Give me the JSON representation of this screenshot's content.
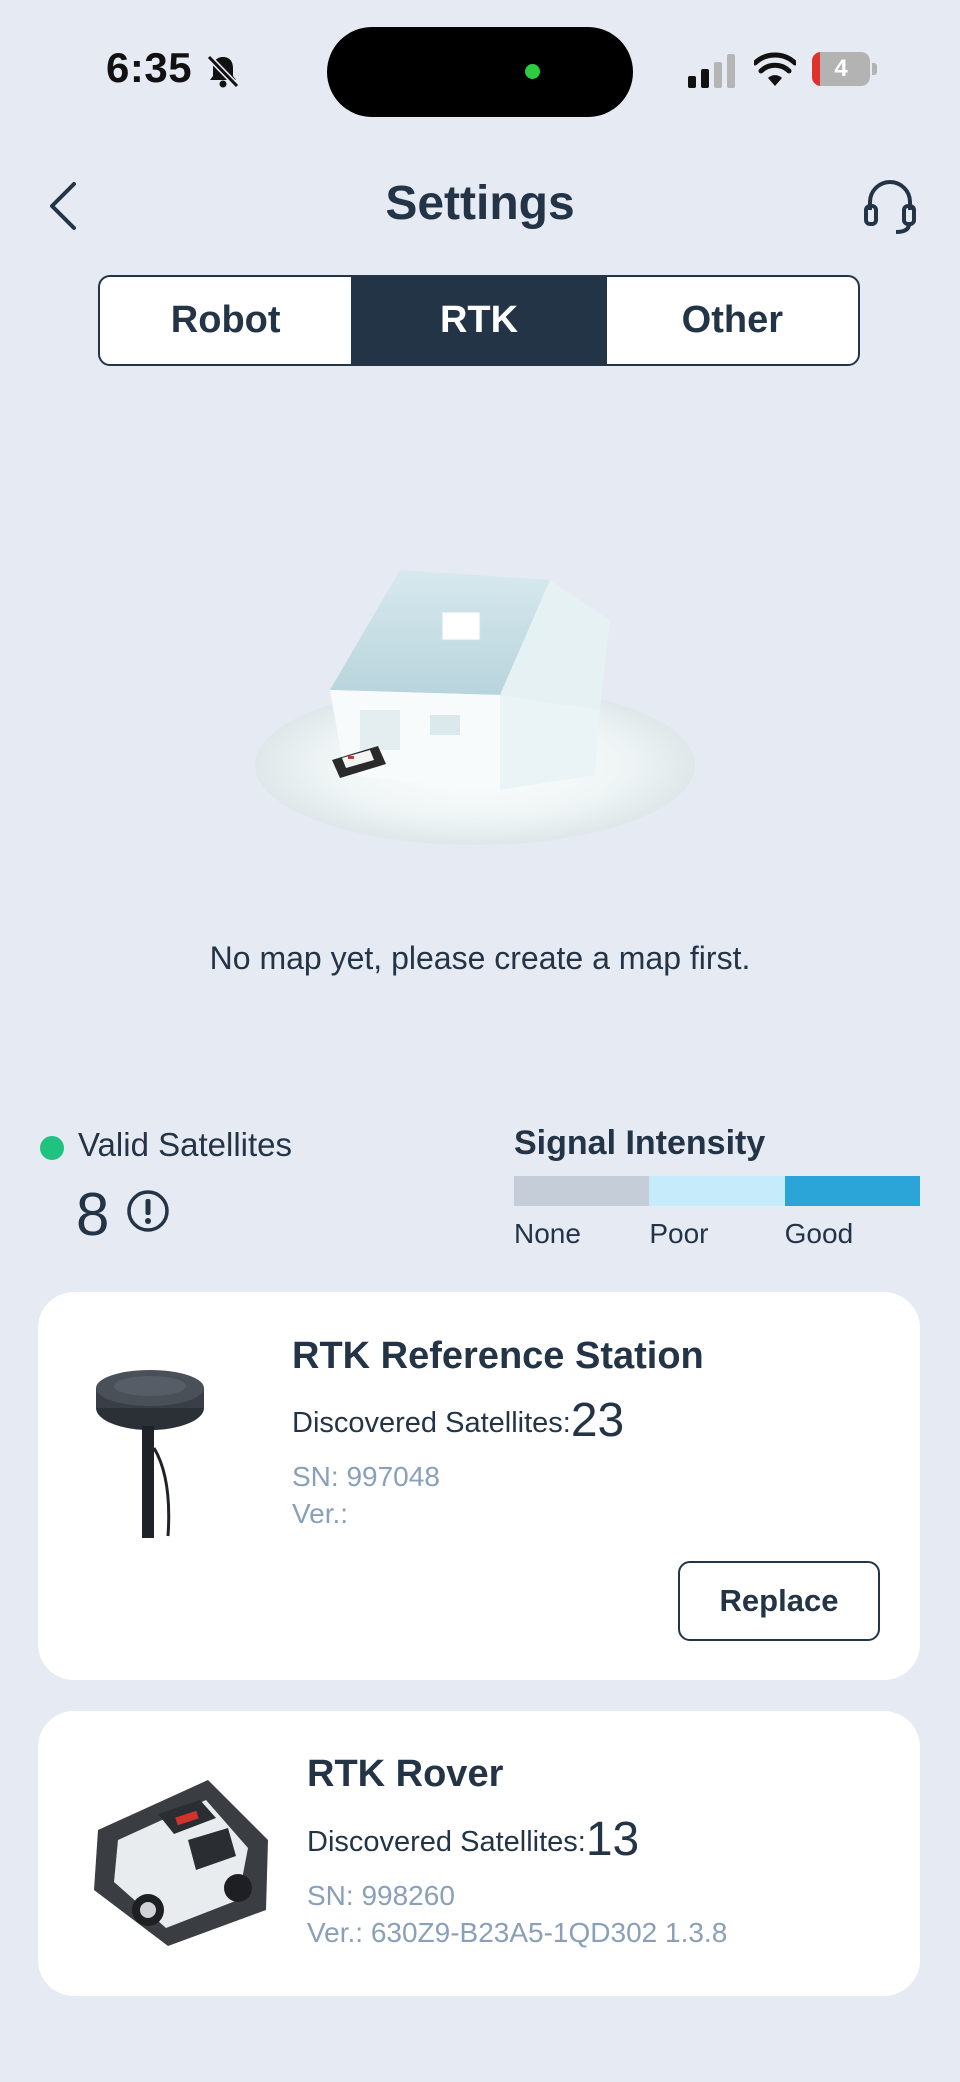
{
  "status_bar": {
    "time": "6:35",
    "battery": "4",
    "icons": [
      "bell-slash-icon",
      "cellular-signal-icon",
      "wifi-icon",
      "battery-icon"
    ]
  },
  "header": {
    "title": "Settings",
    "back_icon": "chevron-left-icon",
    "support_icon": "headset-icon"
  },
  "tabs": [
    {
      "label": "Robot",
      "active": false
    },
    {
      "label": "RTK",
      "active": true
    },
    {
      "label": "Other",
      "active": false
    }
  ],
  "map": {
    "empty_message": "No map yet, please create a map first."
  },
  "satellites": {
    "label": "Valid Satellites",
    "count": "8",
    "status_color": "#1fc27e"
  },
  "signal": {
    "title": "Signal Intensity",
    "levels": [
      {
        "label": "None",
        "color": "#c4cdd8"
      },
      {
        "label": "Poor",
        "color": "#c6ebfa"
      },
      {
        "label": "Good",
        "color": "#2ba5d8"
      }
    ]
  },
  "devices": [
    {
      "title": "RTK Reference Station",
      "sat_label": "Discovered Satellites:",
      "sat_count": "23",
      "sn": "SN: 997048",
      "ver": "Ver.:",
      "action": "Replace"
    },
    {
      "title": "RTK Rover",
      "sat_label": "Discovered Satellites:",
      "sat_count": "13",
      "sn": "SN: 998260",
      "ver": "Ver.: 630Z9-B23A5-1QD302 1.3.8"
    }
  ]
}
